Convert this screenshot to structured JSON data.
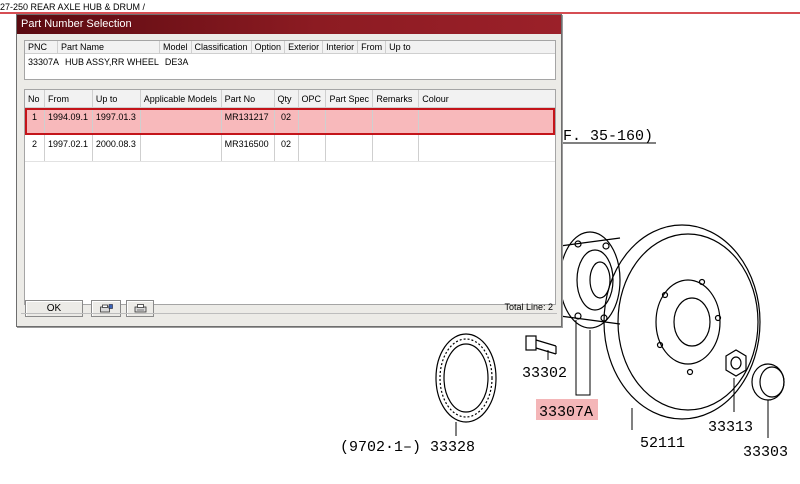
{
  "background": {
    "caption": "27-250  REAR AXLE HUB & DRUM /",
    "ref_label": "F. 35-160)",
    "labels": {
      "p33302": "33302",
      "p33307A": "33307A",
      "p52111": "52111",
      "p33313": "33313",
      "p33303": "33303",
      "p33328": "(9702·1–) 33328"
    },
    "highlight_color": "#f4b6b8"
  },
  "dialog": {
    "title": "Part Number Selection",
    "header": {
      "columns": [
        "PNC",
        "Part Name",
        "Model",
        "Classification",
        "Option",
        "Exterior",
        "Interior",
        "From",
        "Up to"
      ],
      "values": {
        "pnc": "33307A",
        "part_name": "HUB ASSY,RR WHEEL",
        "model": "DE3A"
      }
    },
    "grid": {
      "columns": [
        "No",
        "From",
        "Up to",
        "Applicable Models",
        "Part No",
        "Qty",
        "OPC",
        "Part Spec",
        "Remarks",
        "Colour"
      ],
      "rows": [
        {
          "no": "1",
          "from": "1994.09.1",
          "upto": "1997.01.3",
          "models": "",
          "partno": "MR131217",
          "qty": "02",
          "opc": "",
          "spec": "",
          "remarks": "",
          "colour": ""
        },
        {
          "no": "2",
          "from": "1997.02.1",
          "upto": "2000.08.3",
          "models": "",
          "partno": "MR316500",
          "qty": "02",
          "opc": "",
          "spec": "",
          "remarks": "",
          "colour": ""
        }
      ],
      "selected_row": 0
    },
    "buttons": {
      "ok": "OK",
      "print_preview_icon": "print-preview-icon",
      "print_icon": "printer-icon"
    },
    "total_line": "Total Line: 2",
    "colors": {
      "title_bar": "#8c1b22",
      "selection_fill": "#f8b9bb",
      "selection_border": "#c4141a"
    }
  }
}
